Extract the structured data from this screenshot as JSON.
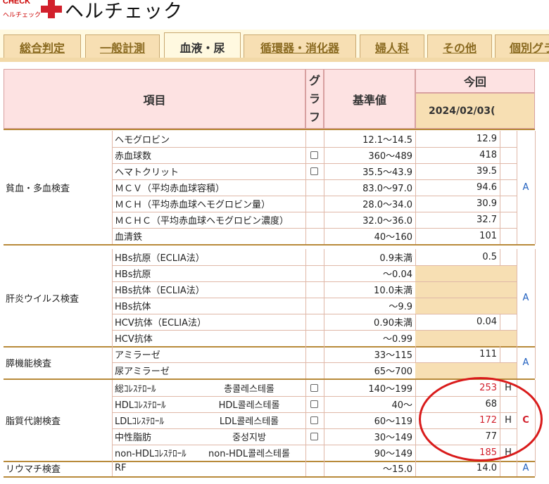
{
  "app": {
    "logo_small_top": "CHECK",
    "logo_small_bottom": "ヘルチェック",
    "title": "ヘルチェック"
  },
  "tabs": [
    {
      "label": "総合判定",
      "active": false
    },
    {
      "label": "一般計測",
      "active": false
    },
    {
      "label": "血液・尿",
      "active": true
    },
    {
      "label": "循環器・消化器",
      "active": false
    },
    {
      "label": "婦人科",
      "active": false
    },
    {
      "label": "その他",
      "active": false
    },
    {
      "label": "個別グラ",
      "active": false
    }
  ],
  "table": {
    "headers": {
      "item": "項目",
      "graph": [
        "グ",
        "ラ",
        "フ"
      ],
      "reference": "基準値",
      "current": "今回",
      "date": "2024/02/03("
    },
    "groups": [
      {
        "category": "貧血・多血検査",
        "grade": "A",
        "rows": [
          {
            "name": "ヘモグロビン",
            "ref": "12.1～14.5",
            "value": "12.9",
            "flag": "",
            "checkbox": false
          },
          {
            "name": "赤血球数",
            "ref": "360～489",
            "value": "418",
            "flag": "",
            "checkbox": true
          },
          {
            "name": "ヘマトクリット",
            "ref": "35.5～43.9",
            "value": "39.5",
            "flag": "",
            "checkbox": true
          },
          {
            "name": "ＭＣＶ（平均赤血球容積）",
            "ref": "83.0～97.0",
            "value": "94.6",
            "flag": "",
            "checkbox": false
          },
          {
            "name": "ＭＣＨ（平均赤血球ヘモグロビン量）",
            "ref": "28.0～34.0",
            "value": "30.9",
            "flag": "",
            "checkbox": false
          },
          {
            "name": "ＭＣＨＣ（平均赤血球ヘモグロビン濃度）",
            "ref": "32.0～36.0",
            "value": "32.7",
            "flag": "",
            "checkbox": false
          },
          {
            "name": "血清鉄",
            "ref": "40～160",
            "value": "101",
            "flag": "",
            "checkbox": false
          }
        ]
      },
      {
        "category": "肝炎ウイルス検査",
        "grade": "A",
        "rows": [
          {
            "name": "HBs抗原（ECLIA法）",
            "ref": "0.9未満",
            "value": "0.5",
            "flag": "",
            "checkbox": false
          },
          {
            "name": "HBs抗原",
            "ref": "～0.04",
            "value": "",
            "flag": "",
            "checkbox": false
          },
          {
            "name": "HBs抗体（ECLIA法）",
            "ref": "10.0未満",
            "value": "",
            "flag": "",
            "checkbox": false
          },
          {
            "name": "HBs抗体",
            "ref": "～9.9",
            "value": "",
            "flag": "",
            "checkbox": false
          },
          {
            "name": "HCV抗体（ECLIA法）",
            "ref": "0.90未満",
            "value": "0.04",
            "flag": "",
            "checkbox": false
          },
          {
            "name": "HCV抗体",
            "ref": "～0.99",
            "value": "",
            "flag": "",
            "checkbox": false
          }
        ]
      },
      {
        "category": "膵機能検査",
        "grade": "A",
        "rows": [
          {
            "name": "アミラーゼ",
            "ref": "33～115",
            "value": "111",
            "flag": "",
            "checkbox": false
          },
          {
            "name": "尿アミラーゼ",
            "ref": "65～700",
            "value": "",
            "flag": "",
            "checkbox": false
          }
        ]
      },
      {
        "category": "脂質代謝検査",
        "grade": "C",
        "rows": [
          {
            "name": "総ｺﾚｽﾃﾛｰﾙ",
            "translation": "총콜레스테롤",
            "ref": "140～199",
            "value": "253",
            "flag": "H",
            "checkbox": true
          },
          {
            "name": "HDLｺﾚｽﾃﾛｰﾙ",
            "translation": "HDL콜레스테롤",
            "ref": "40～",
            "value": "68",
            "flag": "",
            "checkbox": true
          },
          {
            "name": "LDLｺﾚｽﾃﾛｰﾙ",
            "translation": "LDL콜레스테롤",
            "ref": "60～119",
            "value": "172",
            "flag": "H",
            "checkbox": true
          },
          {
            "name": "中性脂肪",
            "translation": "중성지방",
            "ref": "30～149",
            "value": "77",
            "flag": "",
            "checkbox": true
          },
          {
            "name": "non-HDLｺﾚｽﾃﾛｰﾙ",
            "translation": "non-HDL콜레스테롤",
            "ref": "90～149",
            "value": "185",
            "flag": "H",
            "checkbox": false
          }
        ]
      },
      {
        "category": "リウマチ検査",
        "grade": "A",
        "rows": [
          {
            "name": "RF",
            "ref": "～15.0",
            "value": "14.0",
            "flag": "",
            "checkbox": false
          }
        ]
      }
    ]
  },
  "colors": {
    "header_bg": "#fde2e2",
    "tab_bg": "#f7dfb3",
    "high_value": "#d2202c",
    "grade_a": "#1f5fbf",
    "grade_c": "#d2202c",
    "annotation_circle": "#d91b1b"
  }
}
